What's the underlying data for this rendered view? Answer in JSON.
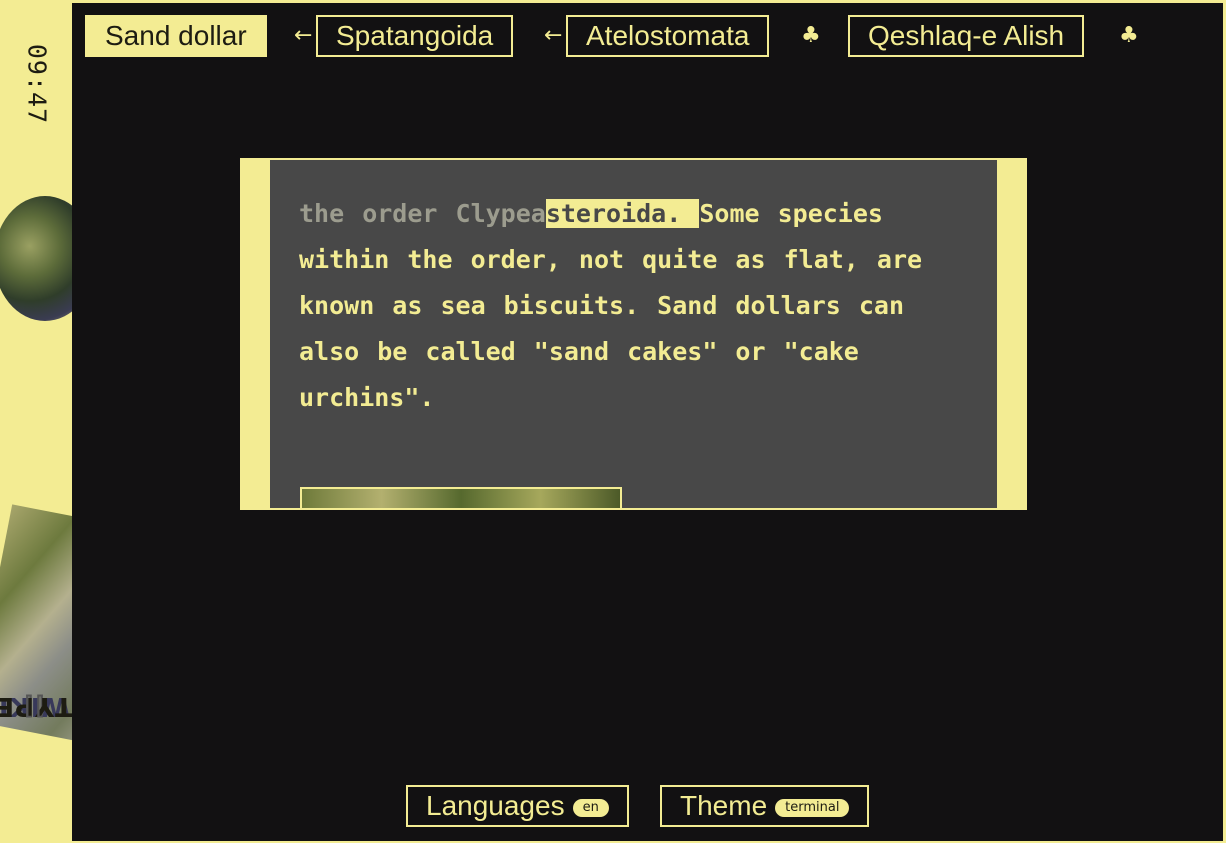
{
  "sidebar": {
    "clock": "09:47",
    "logo_prefix": "[[",
    "logo_wiki": "WIKI",
    "logo_type": "TYPE",
    "logo_suffix": "]]"
  },
  "breadcrumbs": [
    {
      "label": "Sand dollar"
    },
    {
      "label": "Spatangoida"
    },
    {
      "label": "Atelostomata"
    },
    {
      "label": "Qeshlaq-e Alish"
    }
  ],
  "separators": {
    "back": "←",
    "random": "♣"
  },
  "article": {
    "dim": "the order Clypea",
    "dim_highlight": "",
    "highlight": "steroida. ",
    "body": "Some species within the order, not quite as flat, are known as sea biscuits. Sand dollars can also be called \"sand cakes\" or \"cake urchins\"."
  },
  "footer": {
    "languages_label": "Languages",
    "languages_value": "en",
    "theme_label": "Theme",
    "theme_value": "terminal"
  },
  "colors": {
    "accent": "#f3ec93",
    "background": "#121112",
    "panel": "#484848"
  },
  "icons": [
    "left-arrow-icon",
    "club-icon"
  ]
}
